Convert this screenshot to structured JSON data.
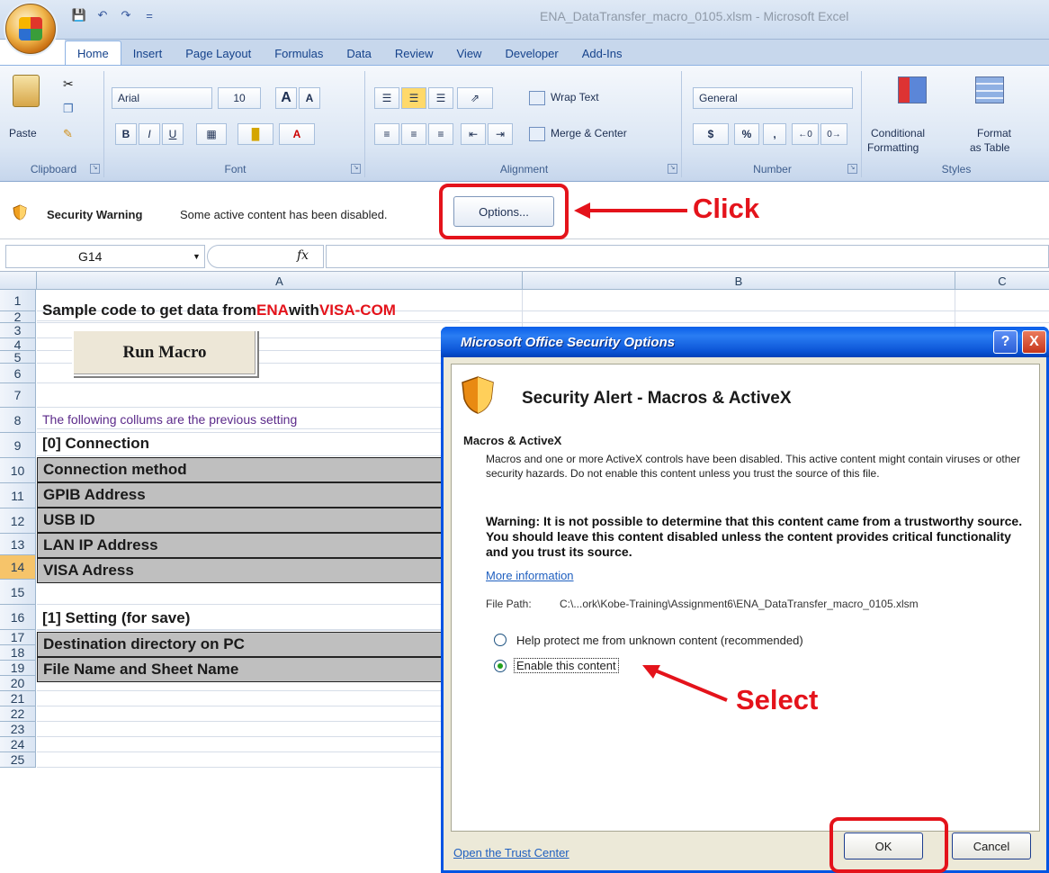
{
  "window": {
    "title": "ENA_DataTransfer_macro_0105.xlsm - Microsoft Excel"
  },
  "qat": {
    "icons": [
      "save-icon",
      "undo-icon",
      "redo-icon",
      "customize-icon"
    ],
    "customize_glyph": "="
  },
  "tabs": [
    "Home",
    "Insert",
    "Page Layout",
    "Formulas",
    "Data",
    "Review",
    "View",
    "Developer",
    "Add-Ins"
  ],
  "ribbon": {
    "clipboard": {
      "label": "Clipboard",
      "paste": "Paste"
    },
    "font": {
      "label": "Font",
      "font_name": "Arial",
      "font_size": "10",
      "grow": "A",
      "shrink": "A",
      "bold": "B",
      "italic": "I",
      "underline": "U"
    },
    "alignment": {
      "label": "Alignment",
      "wrap_text": "Wrap Text",
      "merge_center": "Merge & Center"
    },
    "number": {
      "label": "Number",
      "format": "General",
      "currency": "$",
      "percent": "%",
      "comma": ","
    },
    "styles": {
      "label": "Styles",
      "conditional_1": "Conditional",
      "conditional_2": "Formatting",
      "format_1": "Format",
      "format_2": "as Table"
    }
  },
  "security_bar": {
    "title": "Security Warning",
    "message": "Some active content has been disabled.",
    "options_label": "Options..."
  },
  "formula_bar": {
    "name_box": "G14",
    "fx": "fx"
  },
  "grid": {
    "columns": [
      "A",
      "B",
      "C"
    ],
    "rows": [
      "1",
      "2",
      "3",
      "4",
      "5",
      "6",
      "7",
      "8",
      "9",
      "10",
      "11",
      "12",
      "13",
      "14",
      "15",
      "16",
      "17",
      "18",
      "19",
      "20",
      "21",
      "22",
      "23",
      "24",
      "25"
    ],
    "title_parts": [
      "Sample code to get data from ",
      "ENA",
      " with ",
      "VISA-COM"
    ],
    "macro_button": "Run Macro",
    "note": "The following collums are the previous setting",
    "connection_header": "[0] Connection",
    "connection_rows": [
      "Connection method",
      "GPIB Address",
      "USB ID",
      "LAN IP Address",
      "VISA Adress"
    ],
    "setting_header": "[1] Setting (for save)",
    "setting_rows": [
      "Destination directory on PC",
      "File Name and Sheet Name"
    ]
  },
  "dialog": {
    "title": "Microsoft Office Security Options",
    "help": "?",
    "close": "X",
    "alert_title": "Security Alert - Macros & ActiveX",
    "section": "Macros & ActiveX",
    "description": "Macros and one or more ActiveX controls have been disabled. This active content might contain viruses or other security hazards. Do not enable this content unless you trust the source of this file.",
    "warning": "Warning: It is not possible to determine that this content came from a trustworthy source. You should leave this content disabled unless the content provides critical functionality and you trust its source.",
    "more_info": "More information",
    "file_path_label": "File Path:",
    "file_path": "C:\\...ork\\Kobe-Training\\Assignment6\\ENA_DataTransfer_macro_0105.xlsm",
    "option_protect": "Help protect me from unknown content (recommended)",
    "option_enable": "Enable this content",
    "selected_option": "Enable this content",
    "trust_center": "Open the Trust Center",
    "ok": "OK",
    "cancel": "Cancel"
  },
  "annotations": {
    "click": "Click",
    "select": "Select"
  },
  "colors": {
    "annotation": "#e4131b",
    "dialog_title": "#0054e3",
    "radio_selected": "#22a01c",
    "cell_fill": "#bfbfbf"
  }
}
